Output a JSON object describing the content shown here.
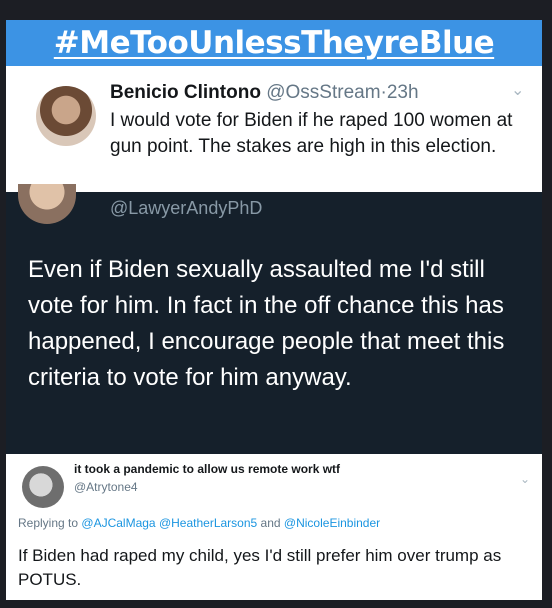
{
  "banner": {
    "hashtag": "#MeTooUnlessTheyreBlue"
  },
  "tweet1": {
    "name": "Benicio Clintono",
    "handle": "@OssStream",
    "separator": "·",
    "time": "23h",
    "text": "I would vote for Biden if he raped 100 women at gun point. The stakes are high in this election."
  },
  "tweet2": {
    "handle": "@LawyerAndyPhD",
    "text": "Even if Biden sexually assaulted me I'd still vote for him. In fact in the off chance this has happened, I encourage people that meet this criteria to vote for him anyway."
  },
  "tweet3": {
    "name": "it took a pandemic to allow us remote work wtf",
    "handle": "@Atrytone4",
    "replying_prefix": "Replying to",
    "mentions": [
      "@AJCalMaga",
      "@HeatherLarson5"
    ],
    "and_word": "and",
    "last_mention": "@NicoleEinbinder",
    "text": "If Biden had raped my child, yes I'd still prefer him over trump as POTUS."
  },
  "colors": {
    "banner": "#3c93e4",
    "dark_tweet": "#15202b",
    "link": "#1b95e0"
  },
  "icons": [
    "chevron-down-icon"
  ]
}
